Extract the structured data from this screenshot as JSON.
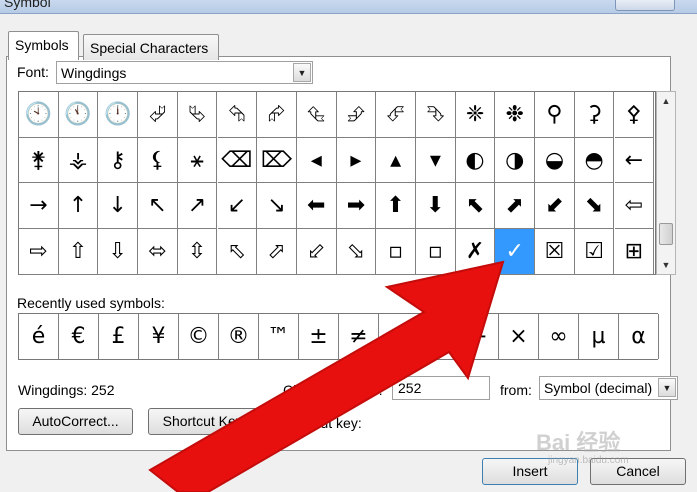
{
  "window": {
    "title": "Symbol"
  },
  "tabs": [
    {
      "label": "Symbols",
      "active": true
    },
    {
      "label": "Special Characters",
      "active": false
    }
  ],
  "font": {
    "label": "Font:",
    "value": "Wingdings"
  },
  "grid": {
    "rows": [
      [
        "🕙",
        "🕚",
        "🕛",
        "⮰",
        "⮱",
        "⮲",
        "⮳",
        "⮴",
        "⮵",
        "⮶",
        "⮷",
        "❈",
        "❉",
        "⚲",
        "⚳",
        "⚴"
      ],
      [
        "⚵",
        "⚶",
        "⚷",
        "⚸",
        "⚹",
        "⌫",
        "⌦",
        "◂",
        "▸",
        "▴",
        "▾",
        "◐",
        "◑",
        "◒",
        "◓",
        "←"
      ],
      [
        "→",
        "↑",
        "↓",
        "↖",
        "↗",
        "↙",
        "↘",
        "⬅",
        "➡",
        "⬆",
        "⬇",
        "⬉",
        "⬈",
        "⬋",
        "⬊",
        "⇦"
      ],
      [
        "⇨",
        "⇧",
        "⇩",
        "⬄",
        "⇳",
        "⬁",
        "⬀",
        "⬃",
        "⬂",
        "▫",
        "▫",
        "✗",
        "✓",
        "☒",
        "☑",
        "⊞"
      ]
    ],
    "selected": {
      "row": 3,
      "col": 12
    }
  },
  "recent": {
    "label": "Recently used symbols:",
    "symbols": [
      "é",
      "€",
      "£",
      "¥",
      "©",
      "®",
      "™",
      "±",
      "≠",
      "≤",
      "≥",
      "÷",
      "×",
      "∞",
      "µ",
      "α"
    ]
  },
  "info": {
    "name": "Wingdings: 252"
  },
  "char_code": {
    "label": "Character code:",
    "value": "252"
  },
  "from": {
    "label": "from:",
    "value": "Symbol (decimal)"
  },
  "buttons": {
    "autocorrect": "AutoCorrect...",
    "shortcut_key": "Shortcut Key...",
    "insert": "Insert",
    "cancel": "Cancel"
  },
  "shortcut_key_label": "Shortcut key:",
  "watermark": {
    "text": "Bai 经验",
    "sub": "jingyan.baidu.com"
  },
  "colors": {
    "selection": "#3399ff",
    "arrow": "#e8100f"
  }
}
